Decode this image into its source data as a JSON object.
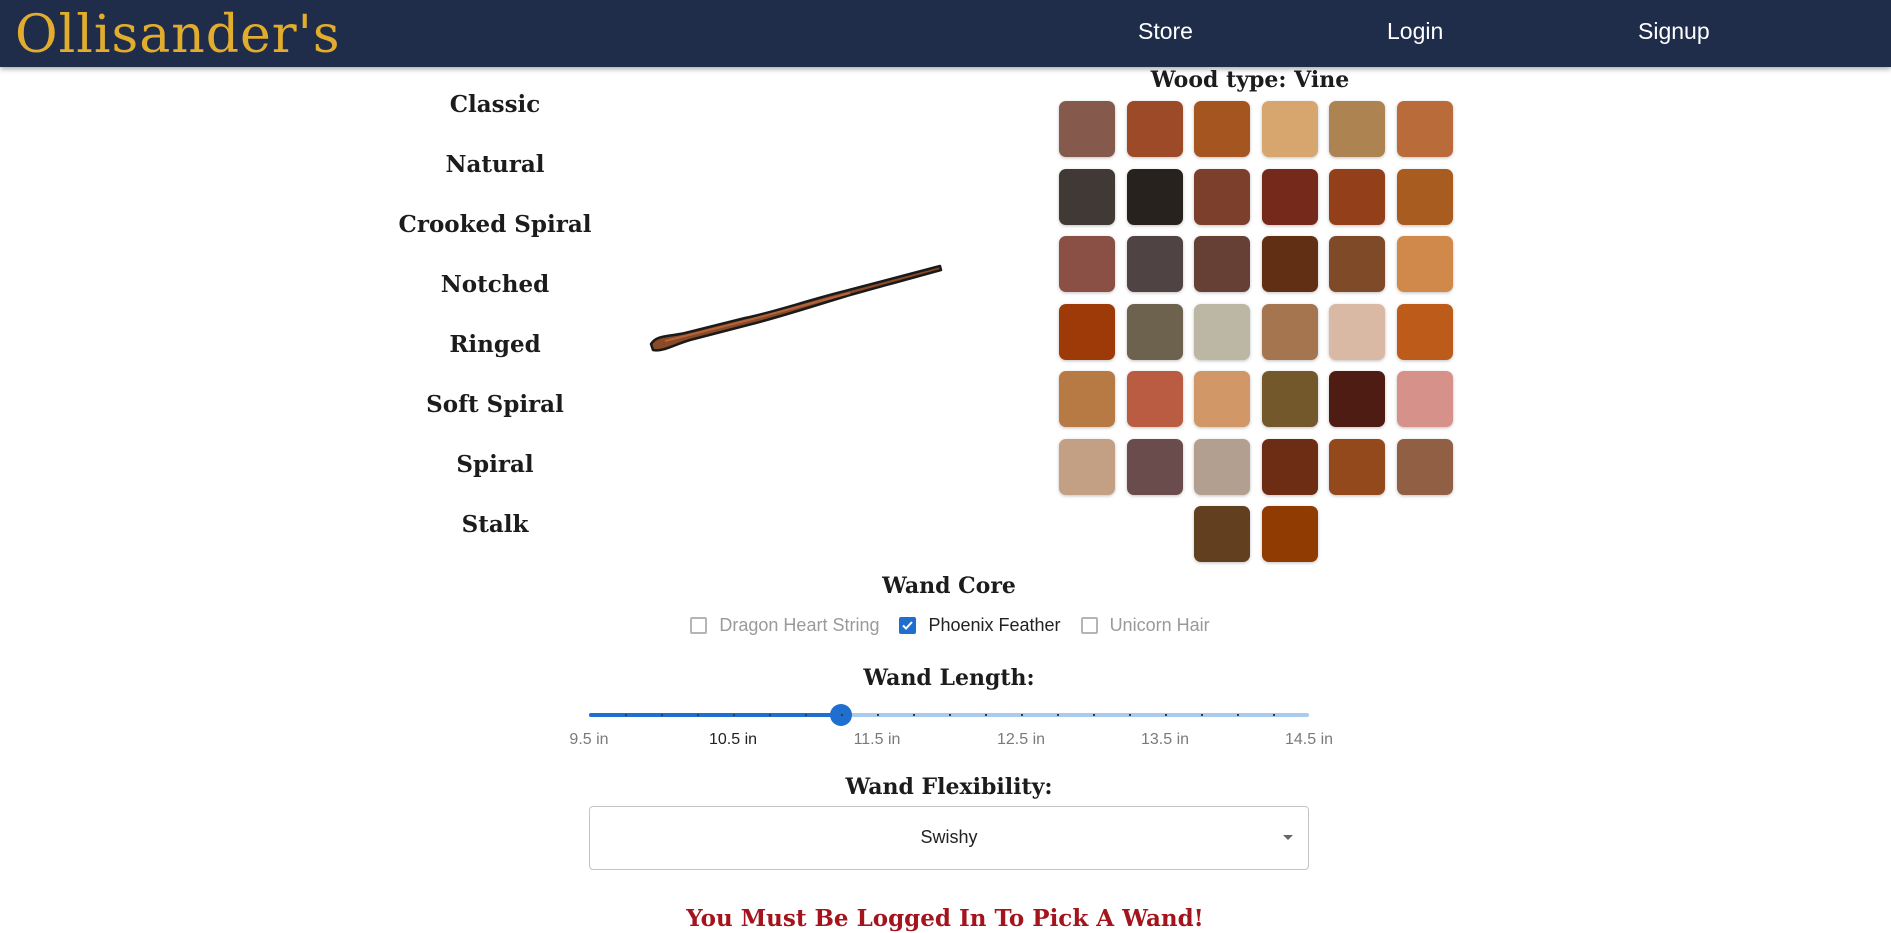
{
  "nav": {
    "brand": "Ollisander's",
    "links": [
      "Store",
      "Login",
      "Signup"
    ]
  },
  "wand_styles": [
    "Classic",
    "Natural",
    "Crooked Spiral",
    "Notched",
    "Ringed",
    "Soft Spiral",
    "Spiral",
    "Stalk"
  ],
  "wood": {
    "title": "Wood type: Vine",
    "swatches": [
      "#855a4c",
      "#9c4a28",
      "#a5551f",
      "#d7a56e",
      "#ae8352",
      "#b96c3a",
      "#403935",
      "#27221e",
      "#7b3f2c",
      "#75291a",
      "#93401a",
      "#a85c20",
      "#8a5045",
      "#4f4443",
      "#663f35",
      "#612f14",
      "#7f4a28",
      "#d1894b",
      "#9e3a08",
      "#6d624d",
      "#bcb7a5",
      "#a5754f",
      "#d9b8a4",
      "#bd5b1a",
      "#b87a45",
      "#b95c42",
      "#d19767",
      "#73582b",
      "#4e1c13",
      "#d6928a",
      "#c39f84",
      "#694c4b",
      "#b29f8f",
      "#6c2d14",
      "#93491c",
      "#905f44",
      "#623f1e",
      "#8f3b02"
    ]
  },
  "core": {
    "title": "Wand Core",
    "options": [
      {
        "label": "Dragon Heart String",
        "checked": false
      },
      {
        "label": "Phoenix Feather",
        "checked": true
      },
      {
        "label": "Unicorn Hair",
        "checked": false
      }
    ]
  },
  "length": {
    "title": "Wand Length:",
    "min": 9.5,
    "max": 14.5,
    "value": 11.25,
    "marks": [
      "9.5 in",
      "10.5 in",
      "11.5 in",
      "12.5 in",
      "13.5 in",
      "14.5 in"
    ],
    "active_mark": 1
  },
  "flexibility": {
    "title": "Wand Flexibility:",
    "value": "Swishy"
  },
  "warning": "You Must Be Logged In To Pick A Wand!",
  "colors": {
    "navbar": "#1f2d4b",
    "brand": "#e2ad2c",
    "accent": "#1e6fcf",
    "warning": "#a4141c"
  }
}
